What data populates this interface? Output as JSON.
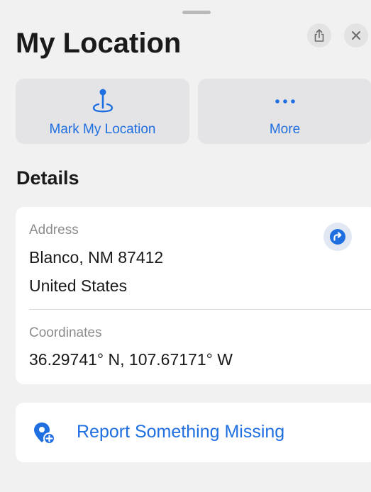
{
  "header": {
    "title": "My Location"
  },
  "actions": {
    "mark_label": "Mark My Location",
    "more_label": "More"
  },
  "details": {
    "heading": "Details",
    "address_label": "Address",
    "address_line1": "Blanco, NM  87412",
    "address_line2": "United States",
    "coordinates_label": "Coordinates",
    "coordinates_value": "36.29741° N, 107.67171° W"
  },
  "report": {
    "label": "Report Something Missing"
  },
  "icons": {
    "share": "share-icon",
    "close": "close-icon",
    "mark": "map-pin-icon",
    "more": "ellipsis-icon",
    "directions": "directions-arrow-icon",
    "report": "report-pin-plus-icon"
  },
  "colors": {
    "accent": "#1f6fe0",
    "sheet_background": "#f1f1f1",
    "card_background": "#ffffff"
  }
}
